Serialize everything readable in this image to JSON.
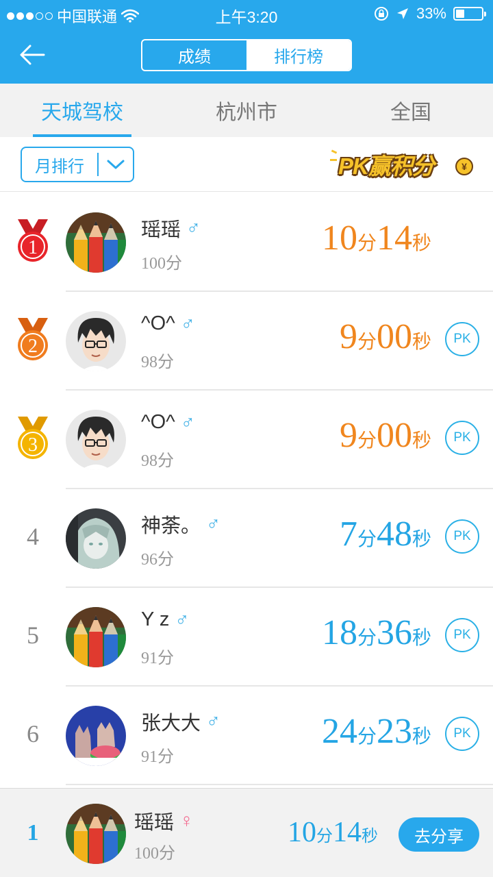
{
  "status_bar": {
    "carrier": "中国联通",
    "time": "上午3:20",
    "battery_text": "33%",
    "battery_level": 0.33
  },
  "header": {
    "back_icon": "back-arrow-icon",
    "tabs": [
      {
        "label": "成绩",
        "active": false
      },
      {
        "label": "排行榜",
        "active": true
      }
    ]
  },
  "region_tabs": [
    {
      "label": "天城驾校",
      "active": true
    },
    {
      "label": "杭州市",
      "active": false
    },
    {
      "label": "全国",
      "active": false
    }
  ],
  "filter": {
    "period": "月排行",
    "pk_banner": "PK赢积分",
    "pk_banner_coin": "¥"
  },
  "colors": {
    "accent": "#28a8ec",
    "gold": "#f4b400",
    "silver_orange": "#f07c1e",
    "first_red": "#e8242a",
    "time_orange": "#f0861e",
    "time_blue": "#24a5e4"
  },
  "ranking": [
    {
      "rank": "1",
      "medal": "gold-red",
      "name": "瑶瑶",
      "gender": "♂",
      "score": "100分",
      "time_min": "10",
      "time_min_unit": "分",
      "time_sec": "14",
      "time_sec_unit": "秒",
      "time_color": "orange",
      "pk": "",
      "avatar": "pencils"
    },
    {
      "rank": "2",
      "medal": "orange",
      "name": "^O^",
      "gender": "♂",
      "score": "98分",
      "time_min": "9",
      "time_min_unit": "分",
      "time_sec": "00",
      "time_sec_unit": "秒",
      "time_color": "orange",
      "pk": "PK",
      "avatar": "boy"
    },
    {
      "rank": "3",
      "medal": "gold",
      "name": "^O^",
      "gender": "♂",
      "score": "98分",
      "time_min": "9",
      "time_min_unit": "分",
      "time_sec": "00",
      "time_sec_unit": "秒",
      "time_color": "orange",
      "pk": "PK",
      "avatar": "boy"
    },
    {
      "rank": "4",
      "medal": "",
      "name": "神荼。",
      "gender": "♂",
      "score": "96分",
      "time_min": "7",
      "time_min_unit": "分",
      "time_sec": "48",
      "time_sec_unit": "秒",
      "time_color": "blue",
      "pk": "PK",
      "avatar": "anime"
    },
    {
      "rank": "5",
      "medal": "",
      "name": "Y z",
      "gender": "♂",
      "score": "91分",
      "time_min": "18",
      "time_min_unit": "分",
      "time_sec": "36",
      "time_sec_unit": "秒",
      "time_color": "blue",
      "pk": "PK",
      "avatar": "pencils"
    },
    {
      "rank": "6",
      "medal": "",
      "name": "张大大",
      "gender": "♂",
      "score": "91分",
      "time_min": "24",
      "time_min_unit": "分",
      "time_sec": "23",
      "time_sec_unit": "秒",
      "time_color": "blue",
      "pk": "PK",
      "avatar": "cats"
    }
  ],
  "my_rank": {
    "rank": "1",
    "name": "瑶瑶",
    "gender": "♀",
    "score": "100分",
    "time_min": "10",
    "time_min_unit": "分",
    "time_sec": "14",
    "time_sec_unit": "秒",
    "share_label": "去分享"
  }
}
